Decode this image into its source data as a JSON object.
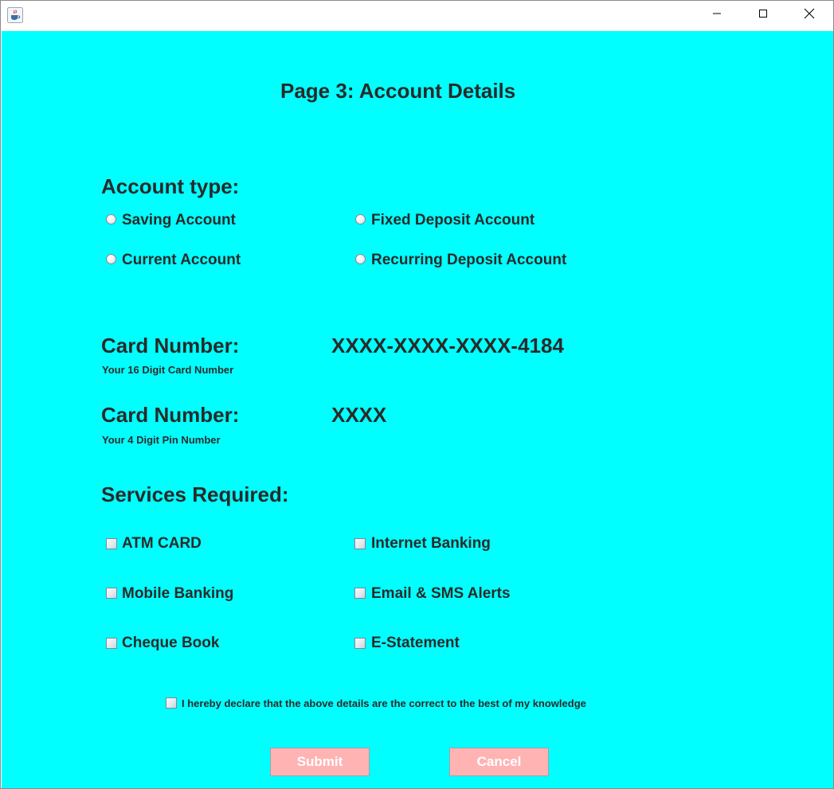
{
  "window": {
    "icon": "java-cup-icon",
    "controls": [
      "minimize",
      "maximize",
      "close"
    ]
  },
  "page_title": "Page 3: Account Details",
  "account_type": {
    "heading": "Account type:",
    "options": [
      "Saving Account",
      "Fixed Deposit Account",
      "Current Account",
      "Recurring Deposit Account"
    ]
  },
  "card_number": {
    "heading": "Card Number:",
    "hint": "Your 16 Digit Card Number",
    "value": "XXXX-XXXX-XXXX-4184"
  },
  "pin_number": {
    "heading": "Card Number:",
    "hint": "Your 4 Digit Pin Number",
    "value": "XXXX"
  },
  "services": {
    "heading": "Services Required:",
    "options": [
      "ATM CARD",
      "Internet Banking",
      "Mobile Banking",
      "Email & SMS Alerts",
      "Cheque Book",
      "E-Statement"
    ]
  },
  "declaration": "I hereby declare that the above details are the correct to the best of my knowledge",
  "buttons": {
    "submit": "Submit",
    "cancel": "Cancel"
  },
  "colors": {
    "background": "#00ffff",
    "button": "#ffb3b3",
    "text": "#2a2a2a"
  }
}
